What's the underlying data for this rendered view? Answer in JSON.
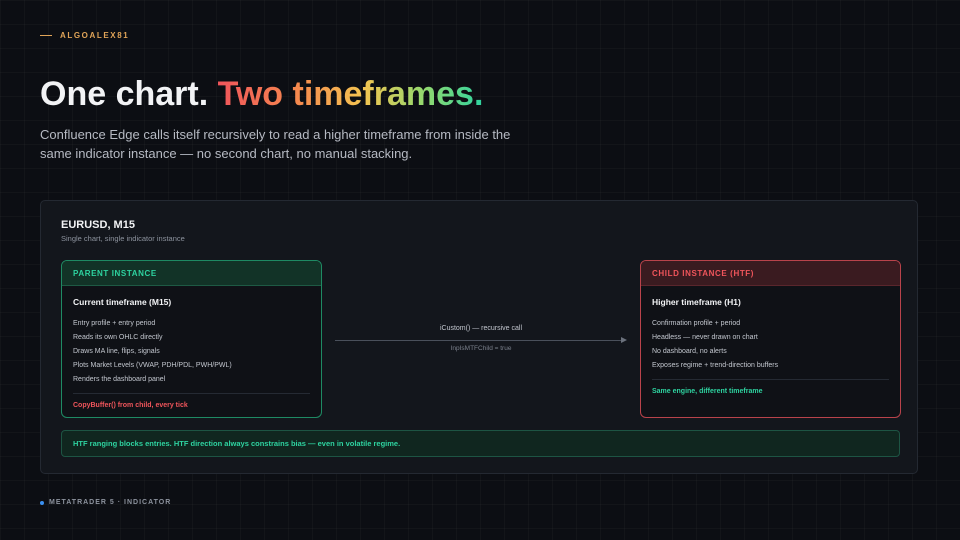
{
  "brand": {
    "name": "ALGOALEX81"
  },
  "hero": {
    "title_plain": "One chart. ",
    "title_gradient": "Two timeframes.",
    "subtitle": "Confluence Edge calls itself recursively to read a higher timeframe from inside the same indicator instance — no second chart, no manual stacking."
  },
  "panel": {
    "title": "EURUSD, M15",
    "subtitle": "Single chart, single indicator instance",
    "parent": {
      "header": "PARENT INSTANCE",
      "title": "Current timeframe (M15)",
      "items": [
        "Entry profile + entry period",
        "Reads its own OHLC directly",
        "Draws MA line, flips, signals",
        "Plots Market Levels (VWAP, PDH/PDL, PWH/PWL)",
        "Renders the dashboard panel"
      ],
      "note": "CopyBuffer() from child, every tick"
    },
    "connector": {
      "label": "iCustom() — recursive call",
      "sublabel": "InpIsMTFChild = true"
    },
    "child": {
      "header": "CHILD INSTANCE (HTF)",
      "title": "Higher timeframe (H1)",
      "items": [
        "Confirmation profile + period",
        "Headless — never drawn on chart",
        "No dashboard, no alerts",
        "Exposes regime + trend-direction buffers"
      ],
      "note": "Same engine, different timeframe"
    },
    "banner": "HTF ranging blocks entries. HTF direction always constrains bias — even in volatile regime."
  },
  "footer": {
    "text": "METATRADER 5 · INDICATOR"
  },
  "colors": {
    "accent_gold": "#e0a458",
    "parent_green": "#2ed3a0",
    "child_red": "#f0555b",
    "footer_dot_blue": "#3a8ff0"
  }
}
